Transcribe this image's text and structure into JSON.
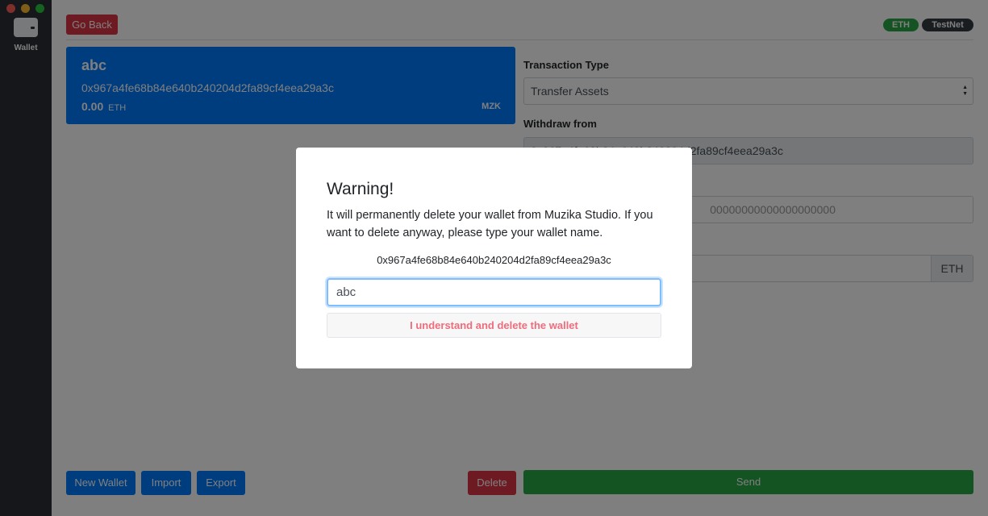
{
  "sidebar": {
    "wallet_label": "Wallet"
  },
  "header": {
    "go_back": "Go Back",
    "network_badge": "ETH",
    "net_badge": "TestNet"
  },
  "wallet_card": {
    "name": "abc",
    "address": "0x967a4fe68b84e640b240204d2fa89cf4eea29a3c",
    "balance": "0.00",
    "balance_unit": "ETH",
    "token": "MZK"
  },
  "form": {
    "transaction_type_label": "Transaction Type",
    "transaction_type_value": "Transfer Assets",
    "withdraw_from_label": "Withdraw from",
    "withdraw_from_value": "0x967a4fe68b84e640b240204d2fa89cf4eea29a3c",
    "to_placeholder": "00000000000000000000",
    "amount_unit": "ETH"
  },
  "footer": {
    "new_wallet": "New Wallet",
    "import": "Import",
    "export": "Export",
    "delete": "Delete",
    "send": "Send"
  },
  "modal": {
    "title": "Warning!",
    "message": "It will permanently delete your wallet from Muzika Studio. If you want to delete anyway, please type your wallet name.",
    "address": "0x967a4fe68b84e640b240204d2fa89cf4eea29a3c",
    "input_value": "abc",
    "confirm_button": "I understand and delete the wallet"
  }
}
